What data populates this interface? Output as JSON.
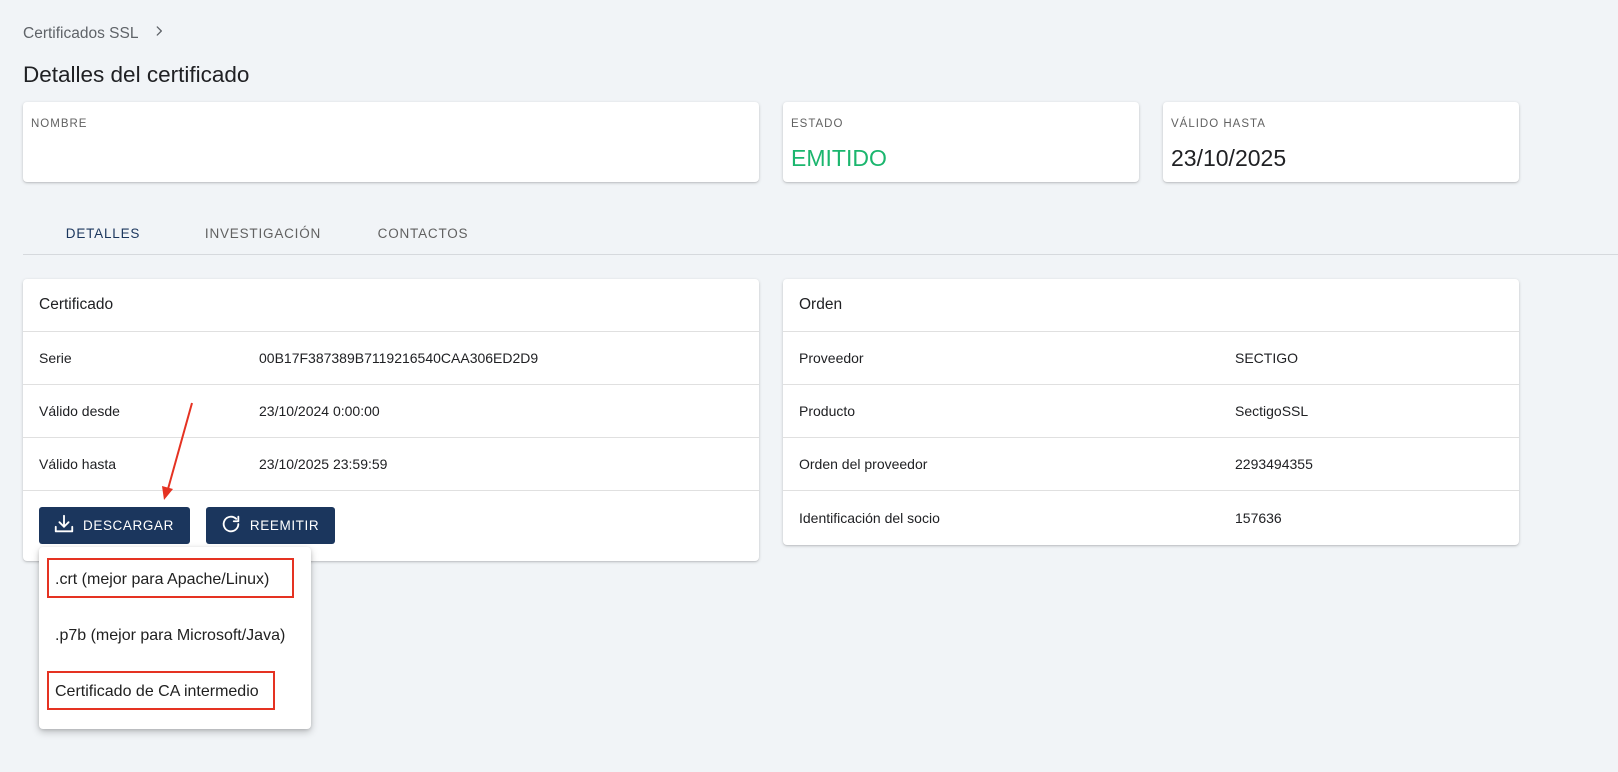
{
  "breadcrumb": {
    "item": "Certificados SSL"
  },
  "page": {
    "title": "Detalles del certificado"
  },
  "stats": {
    "name": {
      "label": "NOMBRE",
      "value": ""
    },
    "status": {
      "label": "ESTADO",
      "value": "EMITIDO"
    },
    "valid_until": {
      "label": "VÁLIDO HASTA",
      "value": "23/10/2025"
    }
  },
  "tabs": [
    {
      "label": "DETALLES"
    },
    {
      "label": "INVESTIGACIÓN"
    },
    {
      "label": "CONTACTOS"
    }
  ],
  "certificate": {
    "title": "Certificado",
    "rows": [
      {
        "label": "Serie",
        "value": "00B17F387389B7119216540CAA306ED2D9"
      },
      {
        "label": "Válido desde",
        "value": "23/10/2024 0:00:00"
      },
      {
        "label": "Válido hasta",
        "value": "23/10/2025 23:59:59"
      }
    ],
    "download_label": "DESCARGAR",
    "reissue_label": "REEMITIR"
  },
  "order": {
    "title": "Orden",
    "rows": [
      {
        "label": "Proveedor",
        "value": "SECTIGO"
      },
      {
        "label": "Producto",
        "value": "SectigoSSL"
      },
      {
        "label": "Orden del proveedor",
        "value": "2293494355"
      },
      {
        "label": "Identificación del socio",
        "value": "157636"
      }
    ]
  },
  "download_menu": {
    "items": [
      {
        "label": ".crt (mejor para Apache/Linux)"
      },
      {
        "label": ".p7b (mejor para Microsoft/Java)"
      },
      {
        "label": "Certificado de CA intermedio"
      }
    ]
  },
  "colors": {
    "primary": "#1b365d",
    "status_green": "#1bb66e",
    "annotation_red": "#e53222",
    "background": "#f1f4f7"
  }
}
